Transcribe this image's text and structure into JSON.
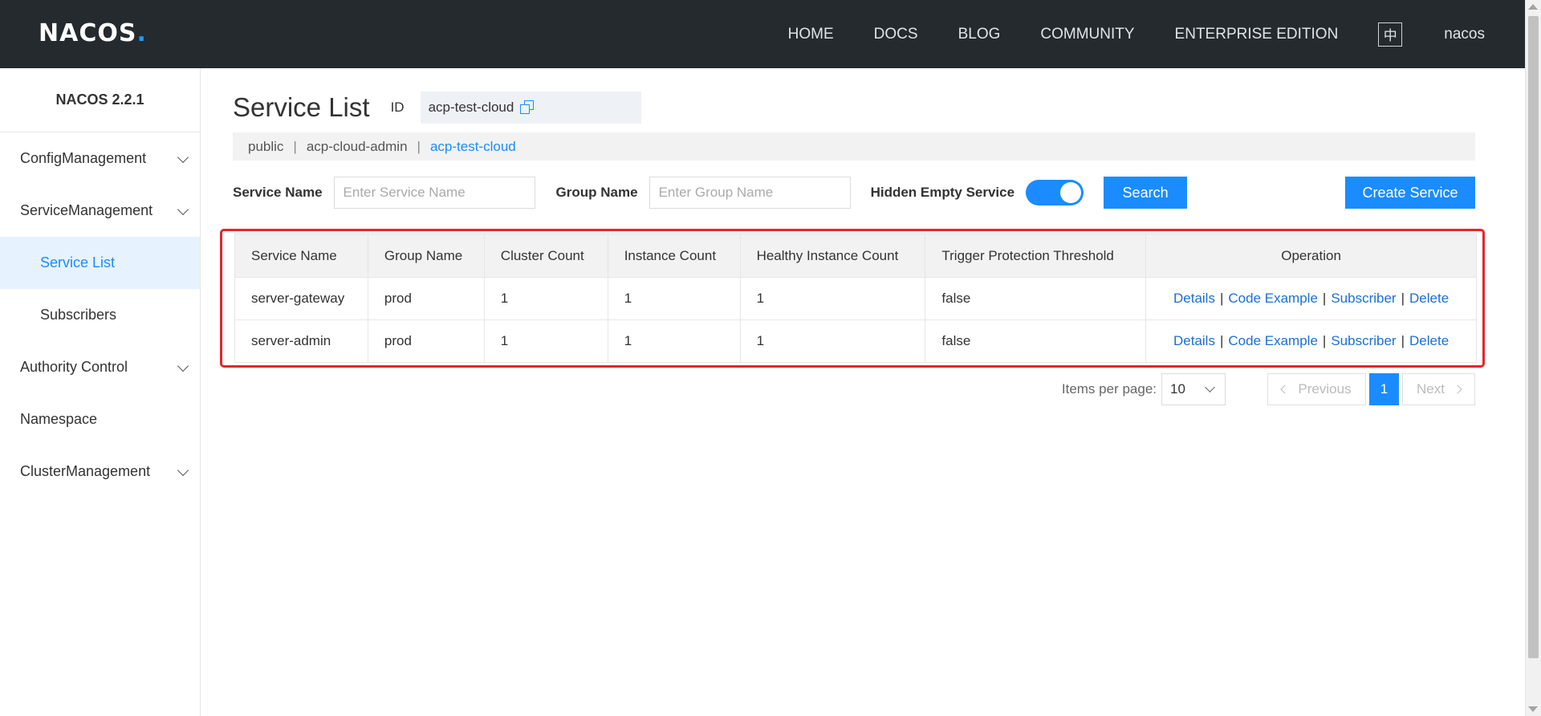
{
  "brand": {
    "logo_text": "NACOS",
    "logo_dot": "."
  },
  "nav": {
    "items": [
      "HOME",
      "DOCS",
      "BLOG",
      "COMMUNITY",
      "ENTERPRISE EDITION"
    ],
    "lang": "中",
    "user": "nacos"
  },
  "sidebar": {
    "version": "NACOS 2.2.1",
    "items": [
      {
        "label": "ConfigManagement"
      },
      {
        "label": "ServiceManagement"
      },
      {
        "label": "Service List"
      },
      {
        "label": "Subscribers"
      },
      {
        "label": "Authority Control"
      },
      {
        "label": "Namespace"
      },
      {
        "label": "ClusterManagement"
      }
    ]
  },
  "page": {
    "title": "Service List",
    "id_label": "ID",
    "id_value": "acp-test-cloud"
  },
  "namespaces": [
    "public",
    "acp-cloud-admin",
    "acp-test-cloud"
  ],
  "filters": {
    "service_name_label": "Service Name",
    "service_name_placeholder": "Enter Service Name",
    "group_name_label": "Group Name",
    "group_name_placeholder": "Enter Group Name",
    "hidden_empty_label": "Hidden Empty Service",
    "search_label": "Search",
    "create_label": "Create Service"
  },
  "table": {
    "headers": [
      "Service Name",
      "Group Name",
      "Cluster Count",
      "Instance Count",
      "Healthy Instance Count",
      "Trigger Protection Threshold",
      "Operation"
    ],
    "rows": [
      [
        "server-gateway",
        "prod",
        "1",
        "1",
        "1",
        "false"
      ],
      [
        "server-admin",
        "prod",
        "1",
        "1",
        "1",
        "false"
      ]
    ],
    "operations": [
      "Details",
      "Code Example",
      "Subscriber",
      "Delete"
    ]
  },
  "pagination": {
    "per_page_label": "Items per page:",
    "per_page_value": "10",
    "prev_label": "Previous",
    "current_page": "1",
    "next_label": "Next"
  }
}
